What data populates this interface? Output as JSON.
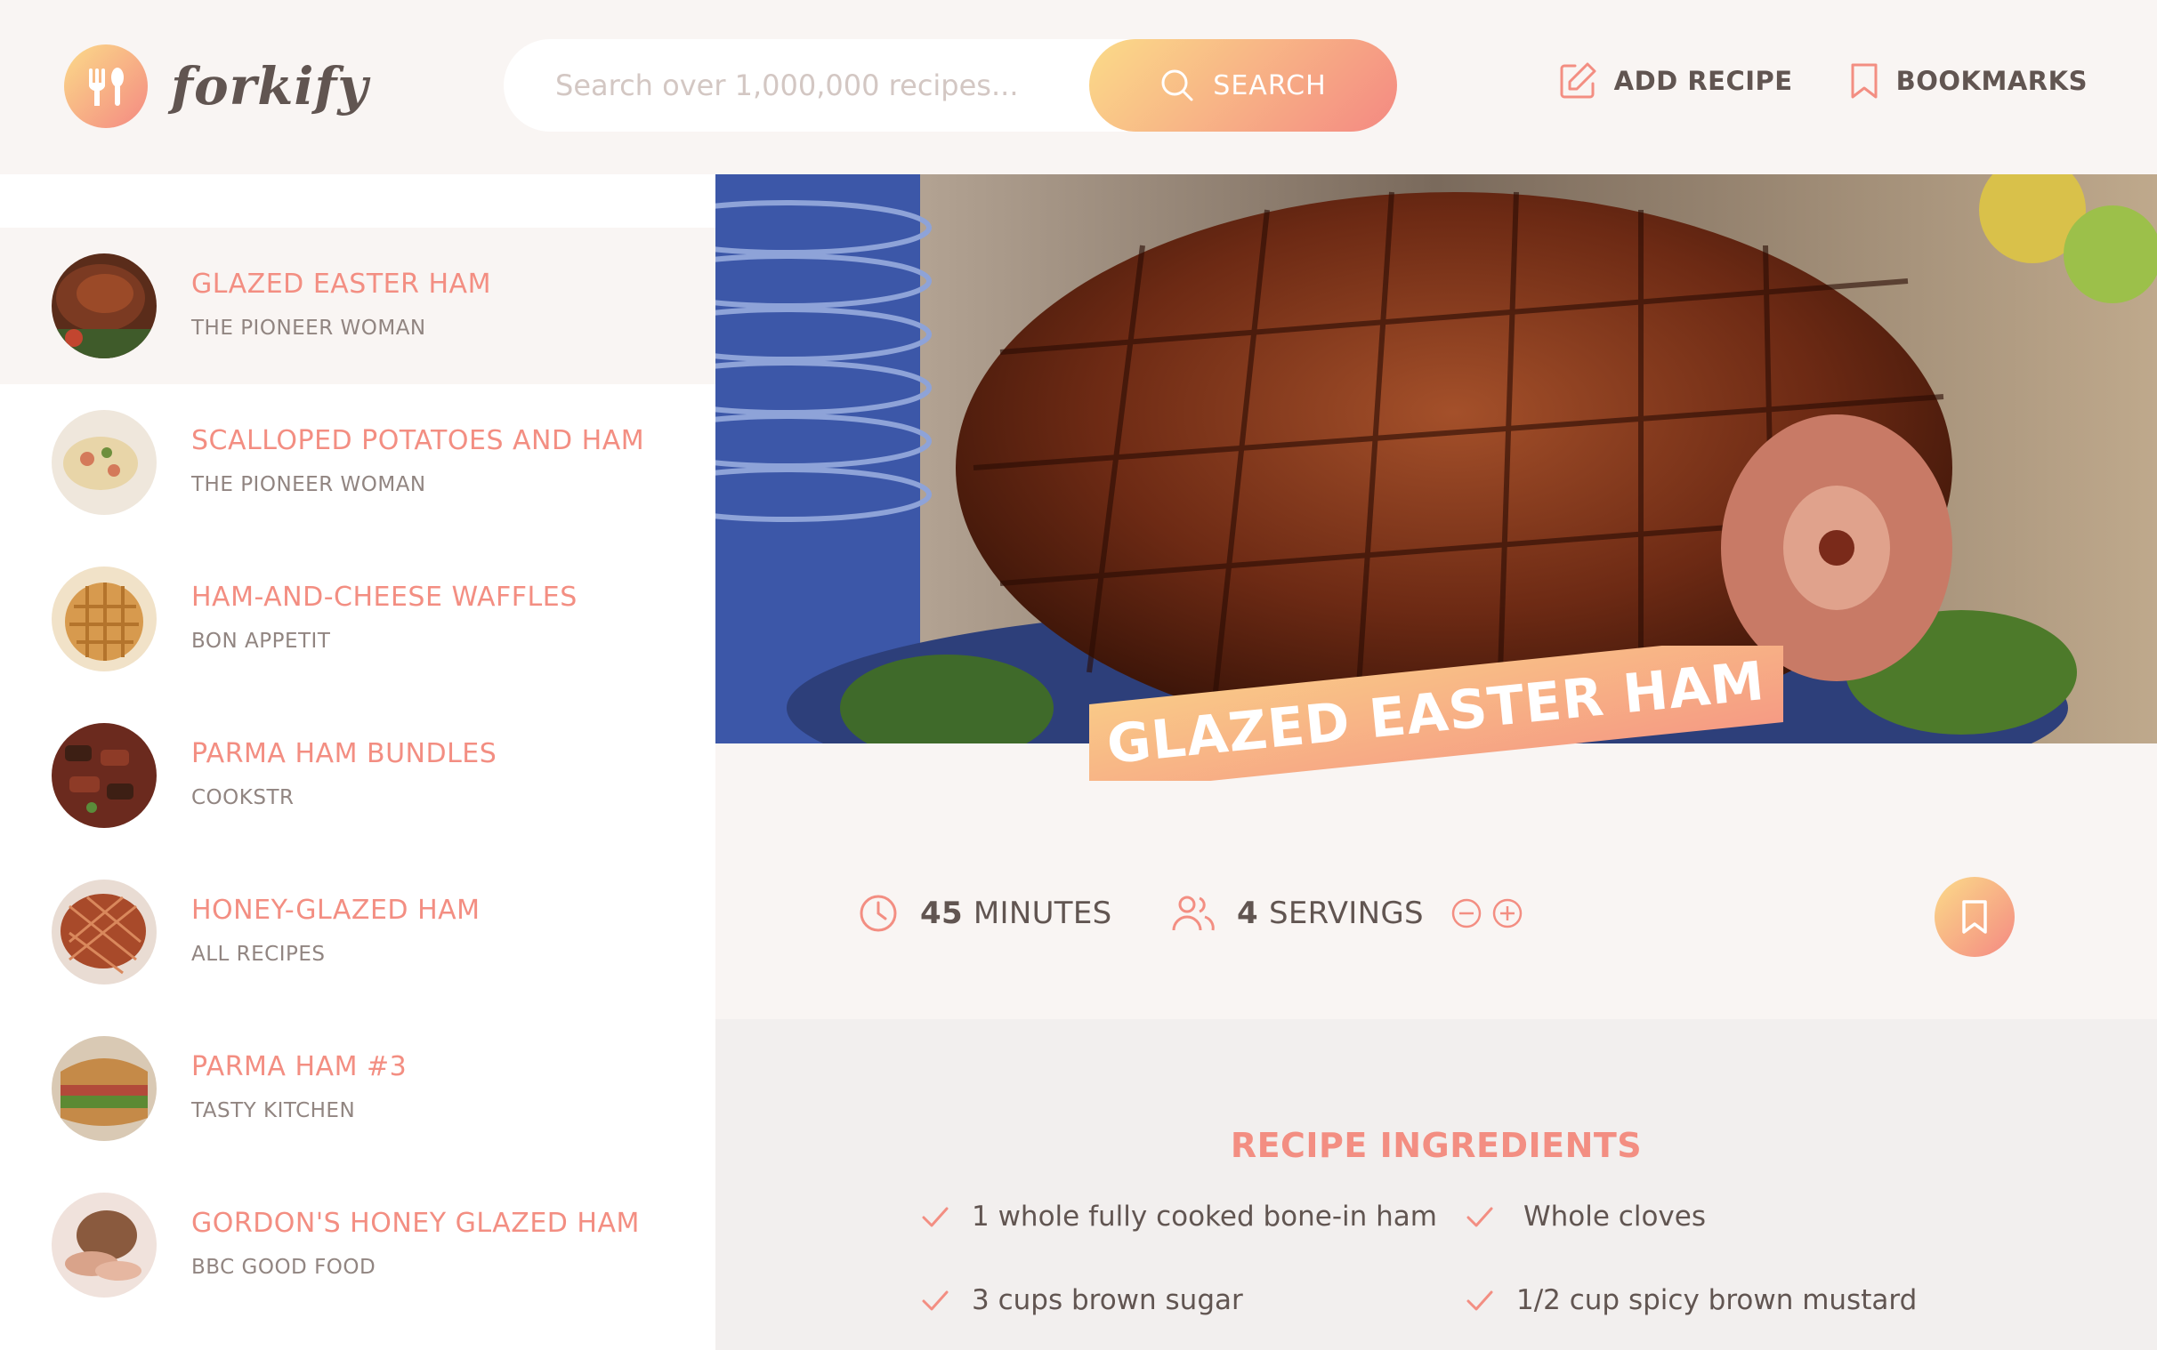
{
  "header": {
    "logo_text": "forkify",
    "search_placeholder": "Search over 1,000,000 recipes...",
    "search_button": "SEARCH",
    "add_recipe": "ADD RECIPE",
    "bookmarks": "BOOKMARKS"
  },
  "results": [
    {
      "title": "GLAZED EASTER HAM",
      "publisher": "THE PIONEER WOMAN",
      "active": true
    },
    {
      "title": "SCALLOPED POTATOES AND HAM",
      "publisher": "THE PIONEER WOMAN",
      "active": false
    },
    {
      "title": "HAM-AND-CHEESE WAFFLES",
      "publisher": "BON APPETIT",
      "active": false
    },
    {
      "title": "PARMA HAM BUNDLES",
      "publisher": "COOKSTR",
      "active": false
    },
    {
      "title": "HONEY-GLAZED HAM",
      "publisher": "ALL RECIPES",
      "active": false
    },
    {
      "title": "PARMA HAM #3",
      "publisher": "TASTY KITCHEN",
      "active": false
    },
    {
      "title": "GORDON'S HONEY GLAZED HAM",
      "publisher": "BBC GOOD FOOD",
      "active": false
    }
  ],
  "recipe": {
    "title": "GLAZED EASTER HAM",
    "cooking_time": "45",
    "cooking_time_unit": "MINUTES",
    "servings": "4",
    "servings_unit": "SERVINGS",
    "ingredients_heading": "RECIPE INGREDIENTS",
    "ingredients": [
      "1 whole fully cooked bone-in ham",
      "Whole cloves",
      "3 cups brown sugar",
      "1/2 cup spicy brown mustard"
    ]
  },
  "colors": {
    "accent": "#f38e82",
    "gradient_start": "#fbdb89",
    "gradient_end": "#f48982",
    "text": "#615551",
    "background": "#f9f5f3"
  }
}
